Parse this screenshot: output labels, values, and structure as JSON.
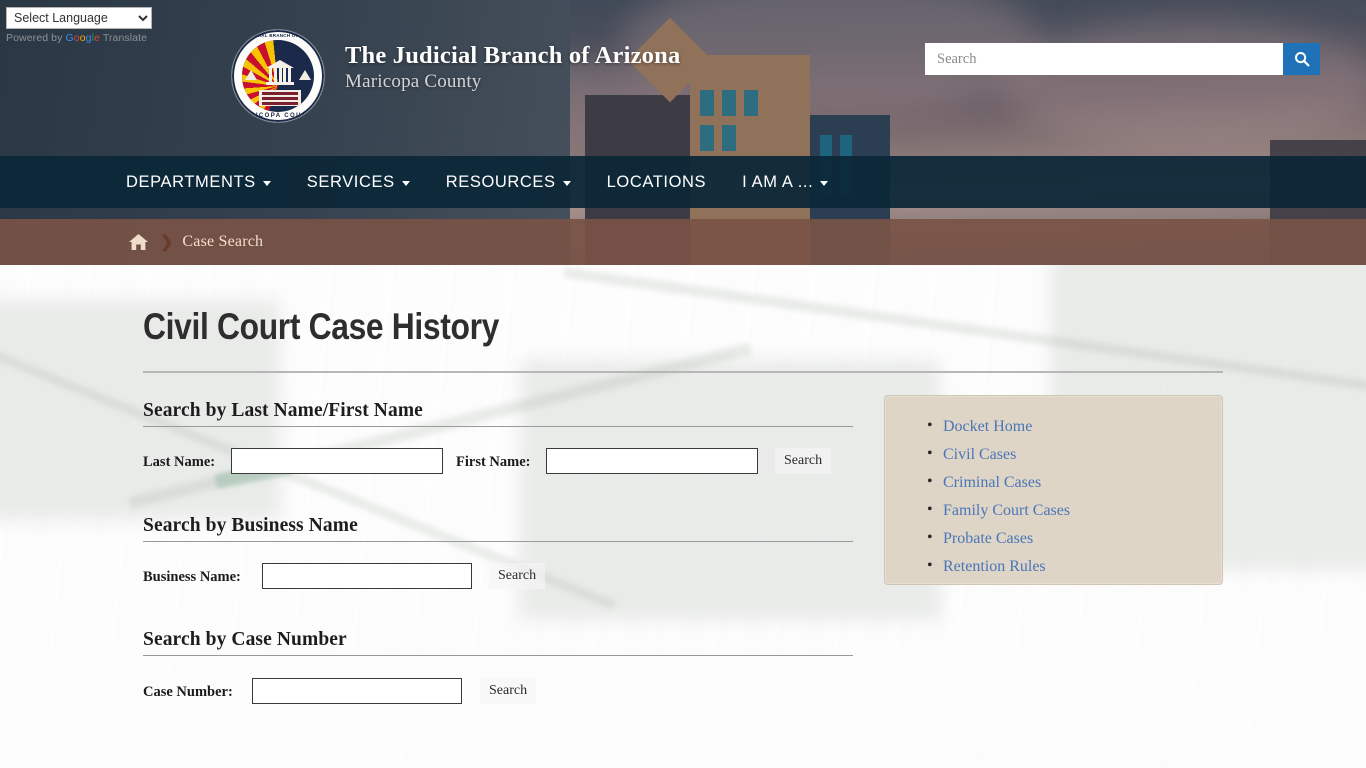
{
  "translate": {
    "select_label": "Select Language",
    "options": [
      "Select Language"
    ],
    "powered_by_prefix": "Powered by ",
    "google": "Google",
    "translate_word": " Translate"
  },
  "header": {
    "seal_top_text": "THE JUDICIAL BRANCH OF ARIZONA",
    "seal_bottom_text": "MARICOPA COUNTY",
    "title": "The Judicial Branch of Arizona",
    "subtitle": "Maricopa County",
    "search_placeholder": "Search",
    "search_value": "",
    "search_icon": "search-icon"
  },
  "nav": {
    "items": [
      {
        "label": "DEPARTMENTS",
        "has_dropdown": true
      },
      {
        "label": "SERVICES",
        "has_dropdown": true
      },
      {
        "label": "RESOURCES",
        "has_dropdown": true
      },
      {
        "label": "LOCATIONS",
        "has_dropdown": false
      },
      {
        "label": "I AM A ...",
        "has_dropdown": true
      }
    ]
  },
  "breadcrumb": {
    "home_icon": "home-icon",
    "separator": "❯",
    "current": "Case Search"
  },
  "main": {
    "page_title": "Civil Court Case History",
    "sections": [
      {
        "heading": "Search by Last Name/First Name",
        "fields": [
          {
            "label": "Last Name:",
            "value": "",
            "placeholder": ""
          },
          {
            "label": "First Name:",
            "value": "",
            "placeholder": ""
          }
        ],
        "button": "Search"
      },
      {
        "heading": "Search by Business Name",
        "fields": [
          {
            "label": "Business Name:",
            "value": "",
            "placeholder": ""
          }
        ],
        "button": "Search"
      },
      {
        "heading": "Search by Case Number",
        "fields": [
          {
            "label": "Case Number:",
            "value": "",
            "placeholder": ""
          }
        ],
        "button": "Search"
      }
    ]
  },
  "sidebar": {
    "links": [
      {
        "label": "Docket Home"
      },
      {
        "label": "Civil Cases"
      },
      {
        "label": "Criminal Cases"
      },
      {
        "label": "Family Court Cases"
      },
      {
        "label": "Probate Cases"
      },
      {
        "label": "Retention Rules"
      }
    ]
  },
  "colors": {
    "nav_bar": "#0b2737",
    "breadcrumb_bar": "#785346",
    "accent_blue": "#1f72b8",
    "link_blue": "#4a76b8",
    "sidebar_bg": "#ded5c6"
  }
}
